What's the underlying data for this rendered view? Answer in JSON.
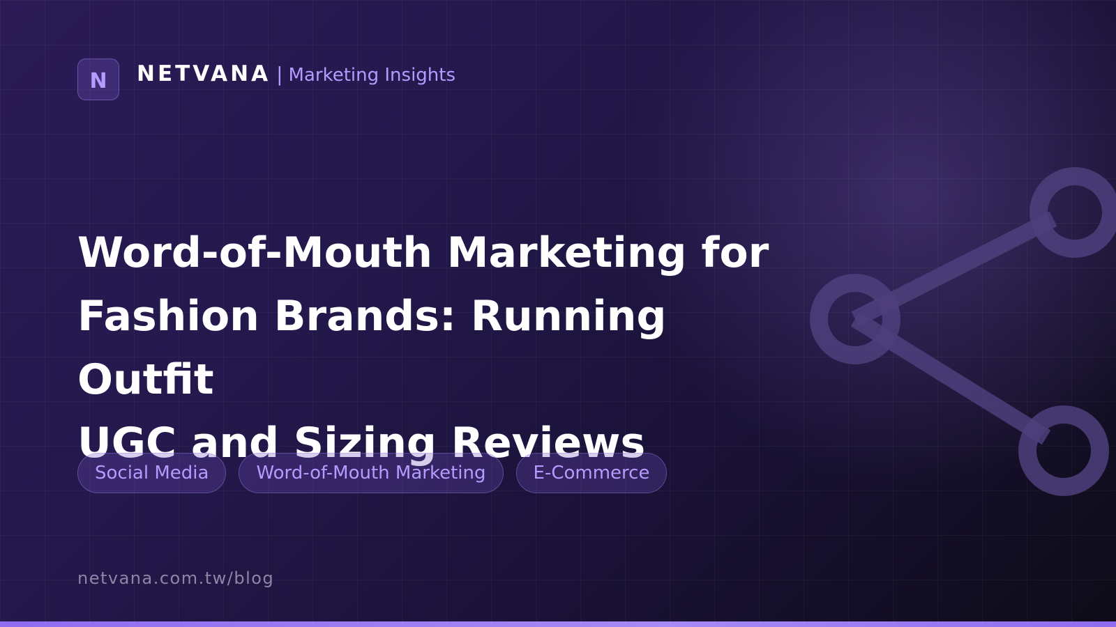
{
  "brand": {
    "logo_letter": "N",
    "name": "NETVANA",
    "separator": "|",
    "subtitle": "Marketing Insights"
  },
  "title_lines": [
    "Word-of-Mouth Marketing for",
    "Fashion Brands: Running Outfit",
    "UGC and Sizing Reviews"
  ],
  "tags": [
    "Social Media",
    "Word-of-Mouth Marketing",
    "E-Commerce"
  ],
  "url": "netvana.com.tw/blog",
  "icons": {
    "decoration": "share-network-icon"
  },
  "colors": {
    "accent": "#b49cff",
    "background_dark": "#1a1238",
    "bottom_bar": "#8f6cf0"
  }
}
